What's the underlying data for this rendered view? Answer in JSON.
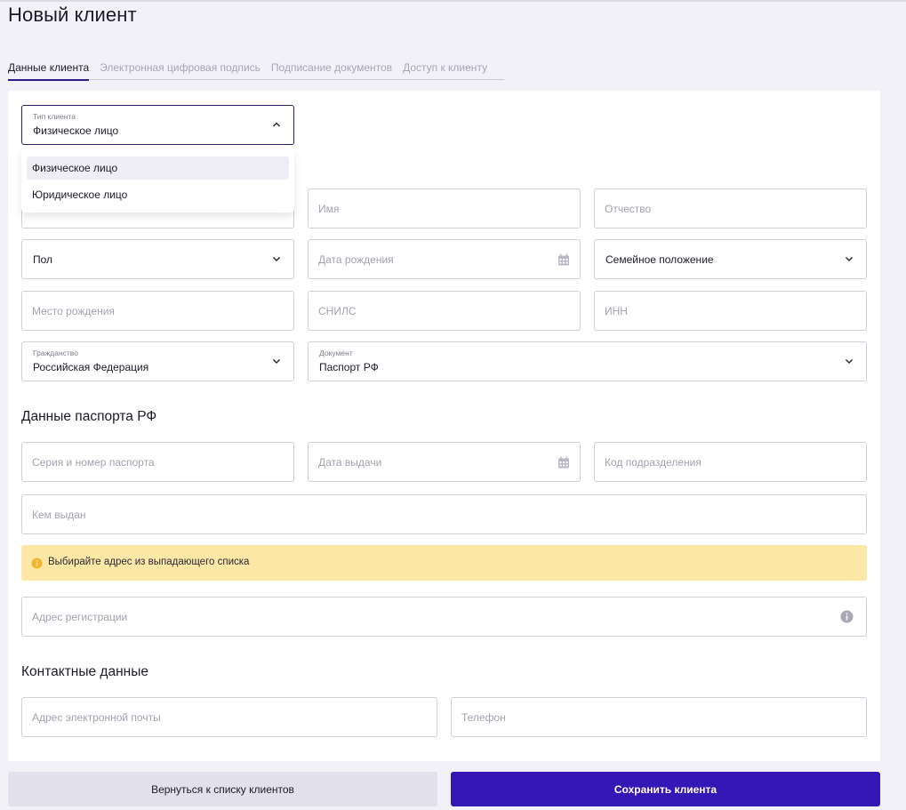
{
  "page": {
    "title": "Новый клиент"
  },
  "tabs": [
    {
      "label": "Данные клиента",
      "active": true
    },
    {
      "label": "Электронная цифровая подпись",
      "active": false
    },
    {
      "label": "Подписание документов",
      "active": false
    },
    {
      "label": "Доступ к клиенту",
      "active": false
    }
  ],
  "client_type": {
    "label": "Тип клиента",
    "value": "Физическое лицо",
    "options": [
      "Физическое лицо",
      "Юридическое лицо"
    ],
    "expanded": true
  },
  "personal": {
    "first_name_placeholder": "Имя",
    "patronymic_placeholder": "Отчество",
    "gender_placeholder": "Пол",
    "birth_date_placeholder": "Дата рождения",
    "marital_status_placeholder": "Семейное положение",
    "birth_place_placeholder": "Место рождения",
    "snils_placeholder": "СНИЛС",
    "inn_placeholder": "ИНН",
    "citizenship": {
      "label": "Гражданство",
      "value": "Российская Федерация"
    },
    "document": {
      "label": "Документ",
      "value": "Паспорт РФ"
    }
  },
  "passport": {
    "section_title": "Данные паспорта РФ",
    "series_number_placeholder": "Серия и номер паспорта",
    "issue_date_placeholder": "Дата выдачи",
    "division_code_placeholder": "Код подразделения",
    "issued_by_placeholder": "Кем выдан"
  },
  "address": {
    "alert_text": "Выбирайте адрес из выпадающего списка",
    "registration_placeholder": "Адрес регистрации"
  },
  "contacts": {
    "section_title": "Контактные данные",
    "email_placeholder": "Адрес электронной почты",
    "phone_placeholder": "Телефон"
  },
  "actions": {
    "back_label": "Вернуться к списку клиентов",
    "save_label": "Сохранить клиента"
  },
  "colors": {
    "primary": "#3417b5",
    "alert_bg": "#fce7a7",
    "alert_icon": "#f2b530",
    "page_bg": "#f2f1f7"
  }
}
